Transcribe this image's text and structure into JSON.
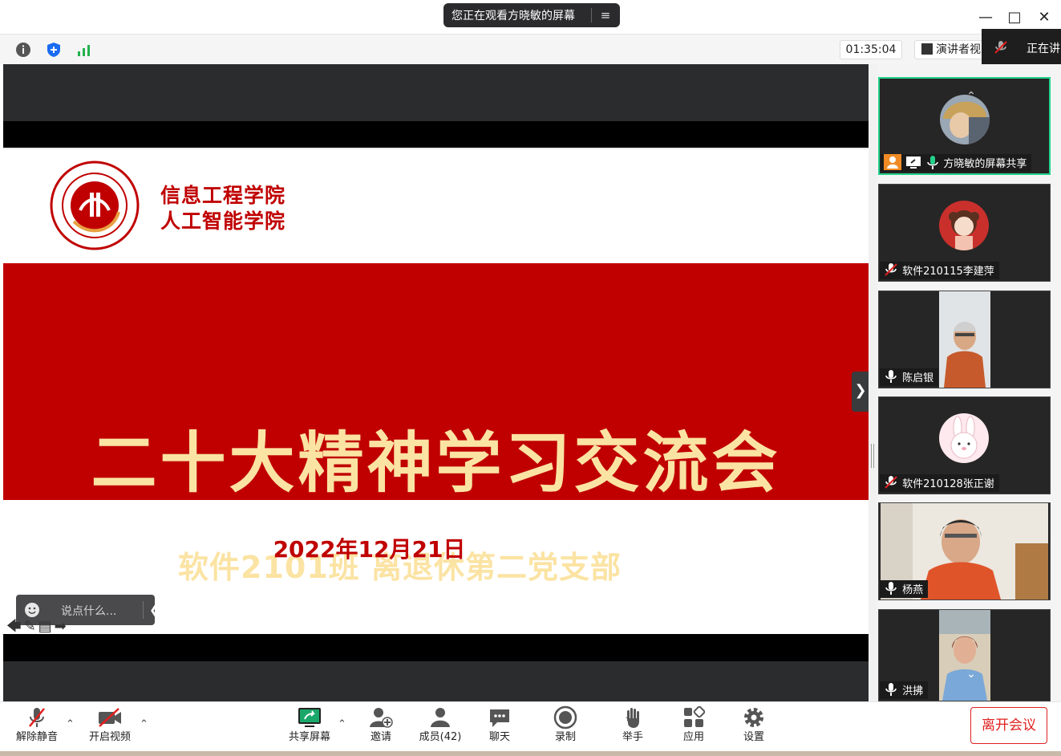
{
  "window": {
    "share_banner": "您正在观看方晓敏的屏幕",
    "timer": "01:35:04",
    "speaker_view": "演讲者视",
    "talking": "正在讲"
  },
  "slide": {
    "school_line1": "信息工程学院",
    "school_line2": "人工智能学院",
    "title": "二十大精神学习交流会",
    "subtitle": "软件2101班  离退休第二党支部",
    "date": "2022年12月21日"
  },
  "chat": {
    "placeholder": "说点什么..."
  },
  "participants": [
    {
      "name": "方晓敏的屏幕共享",
      "mic": "on"
    },
    {
      "name": "软件210115李建萍",
      "mic": "muted"
    },
    {
      "name": "陈启银",
      "mic": "on"
    },
    {
      "name": "软件210128张正谢",
      "mic": "muted"
    },
    {
      "name": "杨燕",
      "mic": "on"
    },
    {
      "name": "洪拂",
      "mic": "on"
    }
  ],
  "bottom_toolbar": {
    "unmute": "解除静音",
    "start_video": "开启视频",
    "share_screen": "共享屏幕",
    "invite": "邀请",
    "members": "成员(42)",
    "chat": "聊天",
    "record": "录制",
    "raise_hand": "举手",
    "apps": "应用",
    "settings": "设置",
    "leave": "离开会议"
  },
  "colors": {
    "slide_red": "#c00000",
    "slide_gold": "#fbe3a3",
    "active_border": "#23d18b",
    "leave_red": "#e0201f"
  }
}
